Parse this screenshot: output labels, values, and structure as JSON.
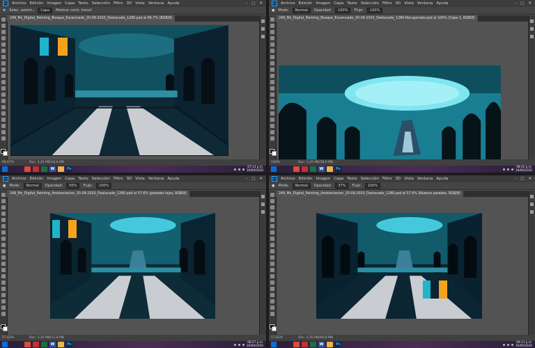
{
  "menu": [
    "Archivo",
    "Edición",
    "Imagen",
    "Capa",
    "Texto",
    "Selección",
    "Filtro",
    "3D",
    "Vista",
    "Ventana",
    "Ayuda"
  ],
  "colors": {
    "ps_blue": "#31a8ff",
    "teal": "#1fb4c9",
    "orange": "#f7a21b",
    "navy": "#0d2233",
    "floor": "#c9cdd2"
  },
  "quadrants": [
    {
      "options": [
        "Selec. autom.:",
        "Capa",
        "Mostrar contr. transf."
      ],
      "tab": "249_Mz_Digital_Painting_Bosque_Escenciado_20-09-2020_Destacado_1280.psd al 66.7% (RGB/8)",
      "zoom": "66,67%",
      "doc": "Doc: 3,35 MB/10,6 MB",
      "clock_time": "07:13 p.m.",
      "clock_date": "19/09/2020"
    },
    {
      "options": [
        "Modo:",
        "Normal",
        "Opacidad:",
        "100%",
        "Flujo:",
        "100%"
      ],
      "tab": "249_Mz_Digital_Painting_Bosque_Escenciado_20-09-2020_Destacado_1280-Recuperado.psd al 100% (Capa 1, RGB/8)",
      "zoom": "100%",
      "doc": "Doc: 3,35 MB/38,9 MB",
      "clock_time": "08:35 p.m.",
      "clock_date": "19/09/2020"
    },
    {
      "options": [
        "Modo:",
        "Normal",
        "Opacidad:",
        "50%",
        "Flujo:",
        "100%"
      ],
      "tab": "249_Mz_Digital_Painting_Ambientacion_20-09-2020_Destacado_1280.psd al 57.6% (paredes lejos, RGB/8)",
      "zoom": "57,62%",
      "doc": "Doc: 3,35 MB/11,8 MB",
      "clock_time": "08:57 p.m.",
      "clock_date": "19/09/2020"
    },
    {
      "options": [
        "Modo:",
        "Normal",
        "Opacidad:",
        "37%",
        "Flujo:",
        "100%"
      ],
      "tab": "249_Mz_Digital_Painting_Ambientacion_20-09-2020_Destacado_1280.psd al 57.6% (Nuevos paredes, RGB/8)",
      "zoom": "57,62%",
      "doc": "Doc: 3,35 MB/66,8 MB",
      "clock_time": "09:13 p.m.",
      "clock_date": "19/09/2020"
    }
  ],
  "taskbar_icons": [
    "chrome",
    "pdf",
    "excel",
    "word",
    "explorer",
    "photoshop"
  ]
}
